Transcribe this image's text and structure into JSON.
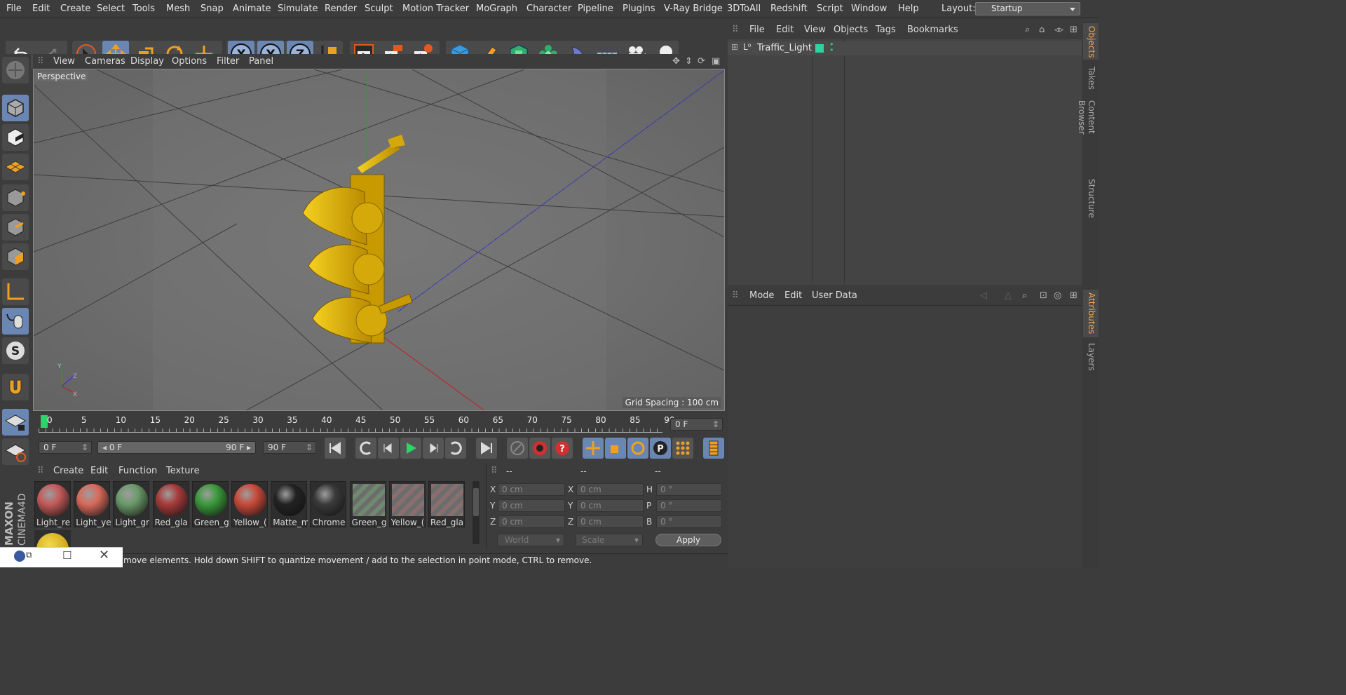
{
  "menubar": {
    "items": [
      "File",
      "Edit",
      "Create",
      "Select",
      "Tools",
      "Mesh",
      "Snap",
      "Animate",
      "Simulate",
      "Render",
      "Sculpt",
      "Motion Tracker",
      "MoGraph",
      "Character",
      "Pipeline",
      "Plugins",
      "V-Ray Bridge",
      "3DToAll",
      "Redshift",
      "Script",
      "Window",
      "Help"
    ],
    "layout_label": "Layout:",
    "layout_value": "Startup"
  },
  "toolbar": {
    "axis_x": "X",
    "axis_y": "Y",
    "axis_z": "Z"
  },
  "viewport": {
    "menu": [
      "View",
      "Cameras",
      "Display",
      "Options",
      "Filter",
      "Panel"
    ],
    "label": "Perspective",
    "grid_spacing": "Grid Spacing : 100 cm",
    "axis_y": "Y",
    "axis_z": "Z",
    "axis_x": "X"
  },
  "timeline": {
    "ticks": [
      "0",
      "5",
      "10",
      "15",
      "20",
      "25",
      "30",
      "35",
      "40",
      "45",
      "50",
      "55",
      "60",
      "65",
      "70",
      "75",
      "80",
      "85",
      "90"
    ],
    "current_frame": "0 F",
    "start_field": "0 F",
    "range_start": "0 F",
    "range_end": "90 F",
    "end_field": "90 F"
  },
  "materials": {
    "menu": [
      "Create",
      "Edit",
      "Function",
      "Texture"
    ],
    "items": [
      {
        "label": "Light_re",
        "color": "#c45a5a"
      },
      {
        "label": "Light_ye",
        "color": "#d86a5a"
      },
      {
        "label": "Light_gr",
        "color": "#6a9a6a"
      },
      {
        "label": "Red_gla",
        "color": "#a83a3a"
      },
      {
        "label": "Green_g",
        "color": "#3a9a3a"
      },
      {
        "label": "Yellow_(",
        "color": "#c84a3a"
      },
      {
        "label": "Matte_m",
        "color": "#222222"
      },
      {
        "label": "Chrome",
        "color": "#3a3a3a"
      },
      {
        "label": "Green_g",
        "color": "#7a9a7a"
      },
      {
        "label": "Yellow_(",
        "color": "#9a7a7a"
      },
      {
        "label": "Red_gla",
        "color": "#9a7a7a"
      }
    ]
  },
  "coords": {
    "headers": [
      "--",
      "--",
      "--"
    ],
    "rows": [
      {
        "a": "X",
        "av": "0 cm",
        "b": "X",
        "bv": "0 cm",
        "c": "H",
        "cv": "0 °"
      },
      {
        "a": "Y",
        "av": "0 cm",
        "b": "Y",
        "bv": "0 cm",
        "c": "P",
        "cv": "0 °"
      },
      {
        "a": "Z",
        "av": "0 cm",
        "b": "Z",
        "bv": "0 cm",
        "c": "B",
        "cv": "0 °"
      }
    ],
    "space": "World",
    "mode": "Scale",
    "apply": "Apply"
  },
  "objects": {
    "menu": [
      "File",
      "Edit",
      "View",
      "Objects",
      "Tags",
      "Bookmarks"
    ],
    "item": "Traffic_Light",
    "tabs": [
      "Objects",
      "Takes",
      "Content Browser",
      "Structure"
    ]
  },
  "attributes": {
    "menu": [
      "Mode",
      "Edit",
      "User Data"
    ],
    "tabs": [
      "Attributes",
      "Layers"
    ]
  },
  "status": {
    "text": "move elements. Hold down SHIFT to quantize movement / add to the selection in point mode, CTRL to remove."
  },
  "brand": {
    "line1": "MAXON",
    "line2": "CINEMA4D"
  },
  "colors": {
    "accent": "#6a86b3",
    "highlight": "#f6a64a",
    "object_yellow": "#e8b60c"
  }
}
